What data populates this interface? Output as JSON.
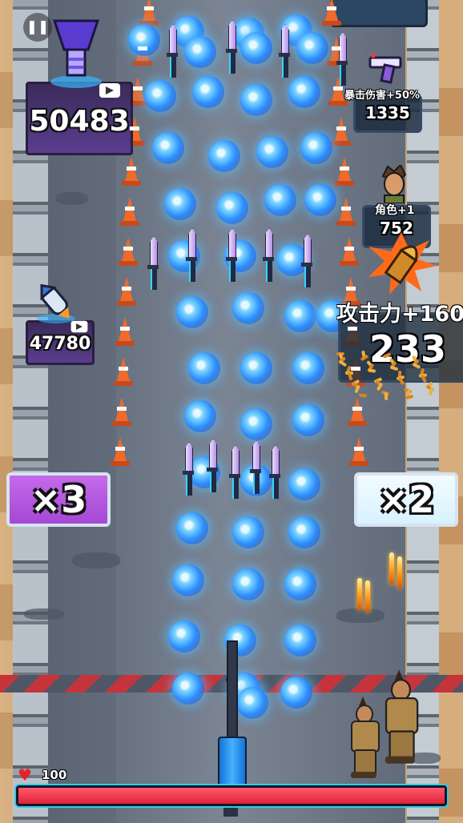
{
  "hud": {
    "pause_symbol": "❚❚",
    "hp_value": "100",
    "hp_fraction": 1.0
  },
  "left_crate_top": {
    "value": "50483",
    "icon": "trophy-pillar-icon"
  },
  "left_crate_mid": {
    "value": "47780",
    "icon": "rocket-missile-icon"
  },
  "right_panels": {
    "crit": {
      "caption": "暴击伤害+50%",
      "value": "1335",
      "icon": "pistol-icon"
    },
    "character": {
      "caption": "角色+1",
      "value": "752",
      "icon": "hero-portrait-icon"
    },
    "attack": {
      "caption": "攻击力+160",
      "value": "233",
      "icon": "bullet-burst-icon"
    }
  },
  "gates": {
    "left": {
      "label": "×3",
      "color": "#a548d6"
    },
    "right": {
      "label": "×2",
      "color": "#d7f2ff"
    }
  },
  "colors": {
    "hazard_red": "#c5343b",
    "orb_blue": "#2a8cff",
    "hp_red": "#e0213a",
    "hp_outline": "#39c6e8"
  }
}
